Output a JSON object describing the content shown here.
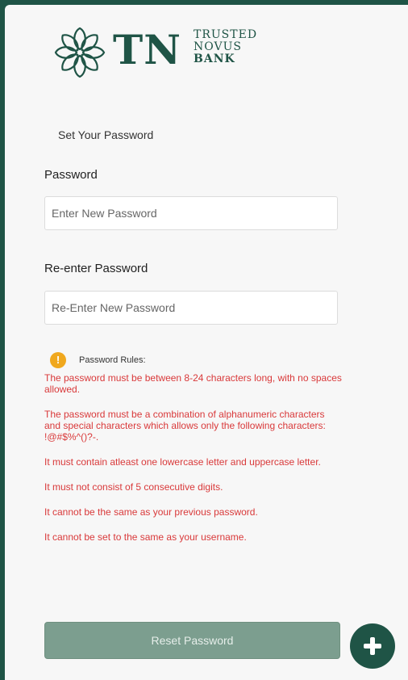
{
  "brand": {
    "logo_letters": "TN",
    "words": [
      "TRUSTED",
      "NOVUS",
      "BANK"
    ],
    "color": "#1f5446"
  },
  "form": {
    "title": "Set Your Password",
    "password": {
      "label": "Password",
      "placeholder": "Enter New Password"
    },
    "confirm": {
      "label": "Re-enter Password",
      "placeholder": "Re-Enter New Password"
    }
  },
  "rules": {
    "icon": "info-icon",
    "title": "Password Rules:",
    "items": [
      "The password must be between 8-24 characters long, with no spaces allowed.",
      "The password must be a combination of alphanumeric characters and special characters which allows only the following characters: !@#$%^()?-.",
      "It must contain atleast one lowercase letter and uppercase letter.",
      "It must not consist of 5 consecutive digits.",
      "It cannot be the same as your previous password.",
      "It cannot be set to the same as your username."
    ],
    "text_color": "#d9393a"
  },
  "actions": {
    "reset_label": "Reset Password",
    "fab_icon": "plus-icon"
  }
}
